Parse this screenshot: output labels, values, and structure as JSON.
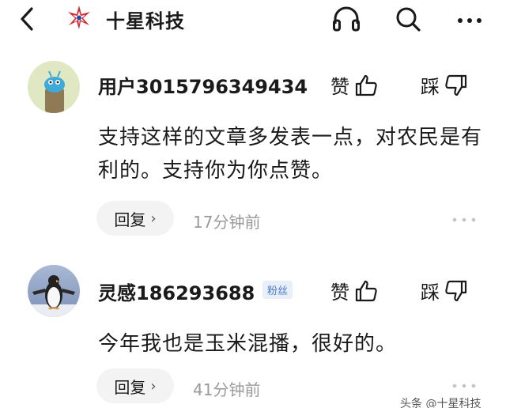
{
  "header": {
    "brand": "十星科技"
  },
  "comments": [
    {
      "username": "用户3015796349434",
      "badge": "",
      "like_label": "赞",
      "dislike_label": "踩",
      "text": "支持这样的文章多发表一点，对农民是有利的。支持你为你点赞。",
      "reply_label": "回复",
      "time": "17分钟前"
    },
    {
      "username": "灵感186293688",
      "badge": "粉丝",
      "like_label": "赞",
      "dislike_label": "踩",
      "text": "今年我也是玉米混播，很好的。",
      "reply_label": "回复",
      "time": "41分钟前"
    }
  ],
  "watermark": "头条 @十星科技",
  "colors": {
    "badge_text": "#4a78c8",
    "badge_bg": "#e8effb",
    "timestamp": "#9a9a9a",
    "reply_bg": "#f3f3f3"
  },
  "icons": [
    "back-arrow-icon",
    "brand-star-logo",
    "headphones-icon",
    "search-icon",
    "more-icon",
    "thumbs-up-icon",
    "thumbs-down-icon",
    "more-dots-icon"
  ]
}
